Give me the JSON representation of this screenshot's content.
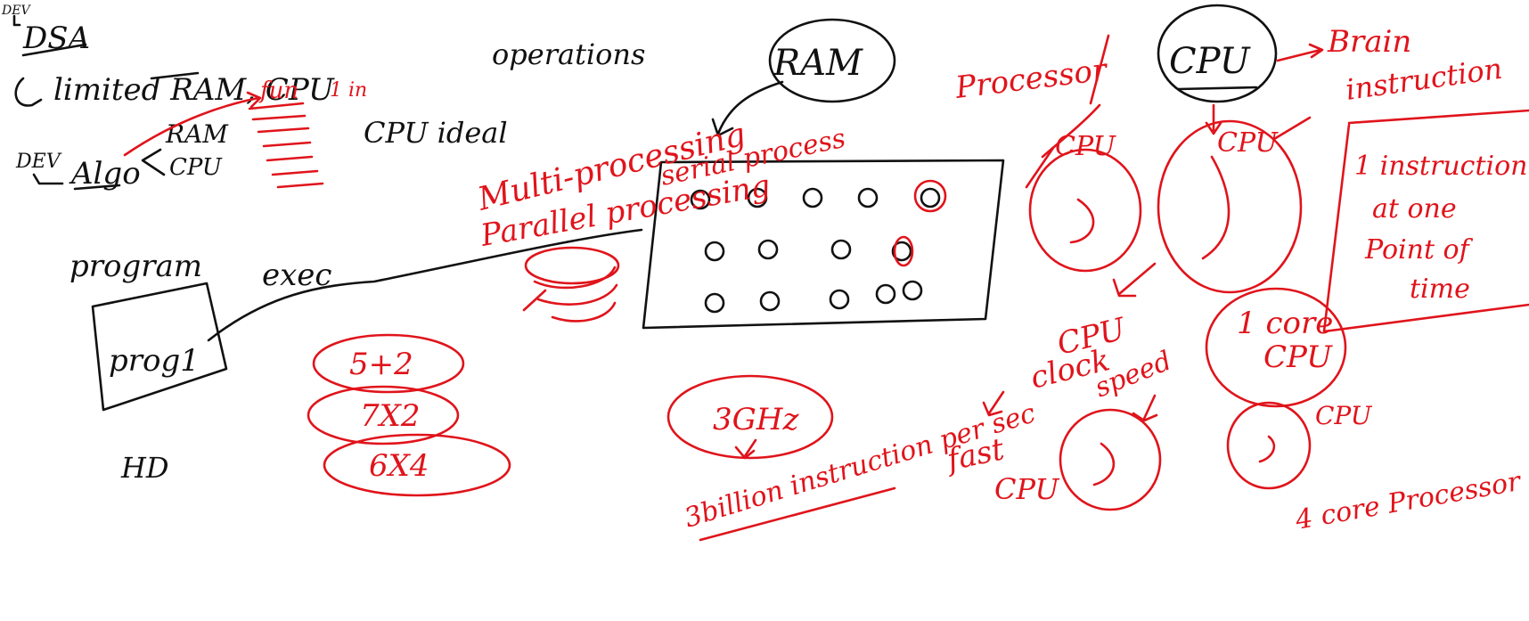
{
  "colors": {
    "ink_black": "#111111",
    "ink_red": "#e0141b",
    "background": "#ffffff"
  },
  "notes": {
    "dev_top": "DEV",
    "dsa": "DSA",
    "limited_ram_cpu": "limited RAM, CPU",
    "dev_left": "DEV",
    "algo": "Algo",
    "ram_small": "RAM",
    "cpu_small": "CPU",
    "fun": "fun",
    "one_in": "1 in",
    "cpu_ideal": "CPU ideal",
    "operations": "operations",
    "program": "program",
    "exec": "exec",
    "prog1": "prog1",
    "hd": "HD",
    "multi_processing": "Multi-processing",
    "parallel_processing": "Parallel processing",
    "serial_process": "serial process",
    "ram_big": "RAM",
    "expr_1": "5+2",
    "expr_2": "7X2",
    "expr_3": "6X4",
    "ghz": "3GHz",
    "billion_instruction": "3billion instruction per sec",
    "processor": "Processor",
    "cpu_big": "CPU",
    "brain": "Brain",
    "instruction": "instruction",
    "cpu_left": "CPU",
    "cpu_mid": "CPU",
    "cpu_label_bottom": "CPU",
    "clock": "clock",
    "speed": "speed",
    "fast": "fast",
    "fast_cpu": "CPU",
    "one_core": "1 core",
    "one_core_cpu": "CPU",
    "one_instruction": "1 instruction",
    "at_one": "at one",
    "point_of": "Point of",
    "time": "time",
    "cpu_right_small": "CPU",
    "four_core": "4 core Processor"
  }
}
